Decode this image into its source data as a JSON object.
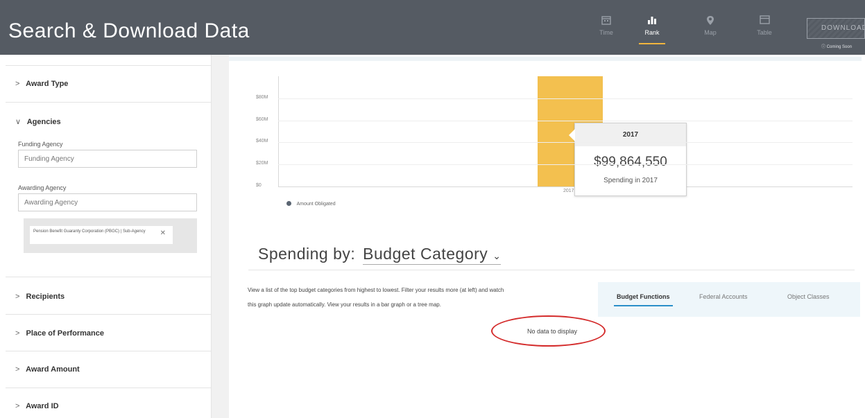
{
  "header": {
    "title": "Search & Download Data",
    "nav": [
      {
        "label": "Time",
        "icon": "calendar-icon"
      },
      {
        "label": "Rank",
        "icon": "bar-chart-icon",
        "active": true
      },
      {
        "label": "Map",
        "icon": "map-pin-icon"
      },
      {
        "label": "Table",
        "icon": "table-icon"
      }
    ],
    "download_label": "DOWNLOAD",
    "coming_soon": "Coming Soon"
  },
  "sidebar": {
    "award_type": "Award Type",
    "agencies": "Agencies",
    "funding_label": "Funding Agency",
    "funding_placeholder": "Funding Agency",
    "awarding_label": "Awarding Agency",
    "awarding_placeholder": "Awarding Agency",
    "chip_text": "Pension Benefit Guaranty Corporation (PBGC) | Sub-Agency",
    "chip_remove": "✕",
    "recipients": "Recipients",
    "place_of_performance": "Place of Performance",
    "award_amount": "Award Amount",
    "award_id": "Award ID"
  },
  "chart_data": {
    "type": "bar",
    "categories": [
      "2017"
    ],
    "values": [
      99864550
    ],
    "y_ticks": [
      "$0",
      "$20M",
      "$40M",
      "$60M",
      "$80M"
    ],
    "y_tick_values": [
      0,
      20000000,
      40000000,
      60000000,
      80000000
    ],
    "ylim": [
      0,
      100000000
    ],
    "legend": "Amount Obligated",
    "bar_color": "#f3c04f",
    "tooltip": {
      "title": "2017",
      "value": "$99,864,550",
      "subtitle": "Spending in 2017"
    }
  },
  "spending": {
    "prefix": "Spending by:",
    "category": "Budget Category",
    "caret": "⌄",
    "description_line1": "View a list of the top budget categories from highest to lowest. Filter your results more (at left) and watch",
    "description_line2": "this graph update automatically. View your results in a bar graph or a tree map.",
    "tabs": [
      "Budget Functions",
      "Federal Accounts",
      "Object Classes"
    ],
    "no_data": "No data to display"
  },
  "colors": {
    "header_bg": "#555b63",
    "accent": "#f2b53d",
    "tab_underline": "#2a8fc9",
    "annotation": "#d42b2b"
  }
}
